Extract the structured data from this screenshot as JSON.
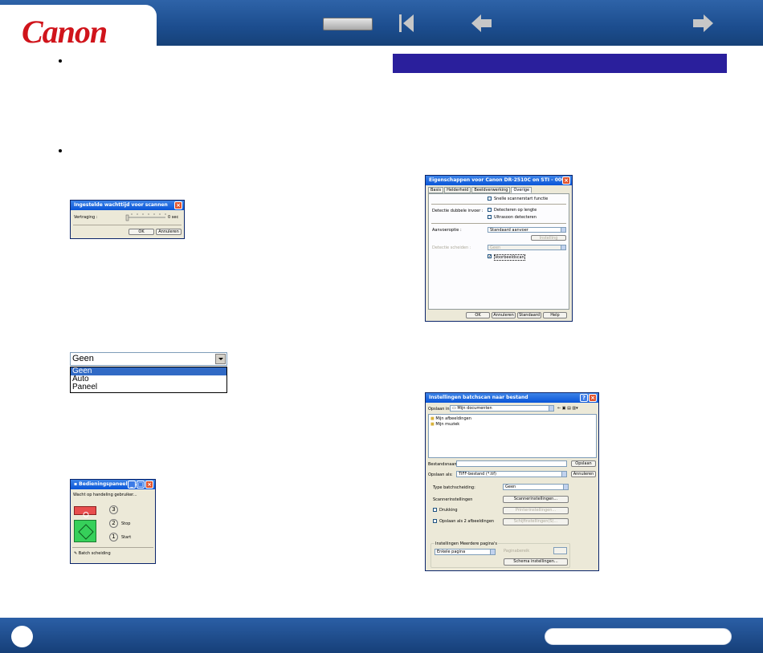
{
  "header": {
    "brand": "Canon",
    "nav": {
      "first_label": "first page",
      "prev_label": "previous page",
      "next_label": "next page"
    }
  },
  "colors": {
    "header_blue": "#1c4d8e",
    "brand_red": "#d0141b",
    "section_bar": "#2a1f9c"
  },
  "dialog_wait": {
    "title": "Ingestelde wachttijd voor scannen",
    "delay_label": "Vertraging :",
    "delay_value": "0 sec",
    "ok": "OK",
    "cancel": "Annuleren"
  },
  "dropdown": {
    "selected": "Geen",
    "options": [
      "Geen",
      "Auto",
      "Paneel"
    ]
  },
  "panel": {
    "title": "Bedieningspaneel s...",
    "status": "Wacht op handeling gebruiker...",
    "steps": [
      {
        "num": "3",
        "label": ""
      },
      {
        "num": "2",
        "label": "Stop"
      },
      {
        "num": "1",
        "label": "Start"
      }
    ],
    "footer_label": "Batch scheiding"
  },
  "props_dialog": {
    "title": "Eigenschappen voor Canon DR-2510C on STI - 0000",
    "tabs": [
      "Basis",
      "Helderheid",
      "Beeldverwerking",
      "Overige"
    ],
    "fast_scan": "Snelle scannerstart functie",
    "double_feed_label": "Detectie dubbele invoer :",
    "double_feed_length": "Detecteren op lengte",
    "ultrasonic": "Ultrasoon detecteren",
    "feed_label": "Aanvoeroptie :",
    "feed_value": "Standaard aanvoer",
    "settings_btn": "Instelling",
    "batch_label": "Detectie scheiden :",
    "batch_value": "Geen",
    "prescan": "Voorbeeldscan",
    "ok": "OK",
    "cancel": "Annuleren",
    "standard": "Standaard",
    "help": "Help"
  },
  "save_dialog": {
    "title": "Instellingen batchscan naar bestand",
    "look_in_label": "Opslaan in:",
    "look_in_value": "Mijn documenten",
    "files": [
      "Mijn afbeeldingen",
      "Mijn muziek"
    ],
    "filename_label": "Bestandsnaam:",
    "savetype_label": "Opslaan als:",
    "savetype_value": "TIFF-bestand (*.tif)",
    "save_btn": "Opslaan",
    "cancel_btn": "Annuleren",
    "separation_label": "Type batchscheiding:",
    "separation_value": "Geen",
    "scanner_settings_label": "Scannerinstellingen",
    "scanner_settings_btn": "Scannerinstellingen...",
    "print_label": "Drukking",
    "print_btn": "Printerinstellingen...",
    "save_two_label": "Opslaan als 2 afbeeldingen",
    "ext_btn": "Schijfinstellingen(S)...",
    "multipage_label": "Instellingen Meerdere pagina's",
    "multipage_value": "Enkele pagina",
    "pages_label": "Paginabereik",
    "scheme_btn": "Schema instellingen..."
  }
}
